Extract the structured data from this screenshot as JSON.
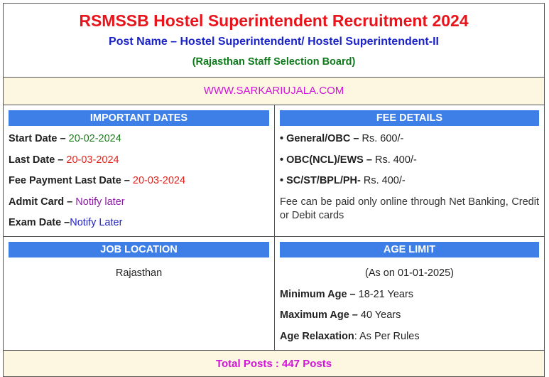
{
  "header": {
    "title": "RSMSSB Hostel Superintendent Recruitment 2024",
    "post_name": "Post Name – Hostel Superintendent/ Hostel Superintendent-II",
    "board": "(Rajasthan Staff Selection Board)"
  },
  "website": "WWW.SARKARIUJALA.COM",
  "important_dates": {
    "heading": "IMPORTANT DATES",
    "start_label": "Start Date –",
    "start_value": "20-02-2024",
    "last_label": "Last Date –",
    "last_value": "20-03-2024",
    "fee_last_label": "Fee Payment Last Date –",
    "fee_last_value": "20-03-2024",
    "admit_label": "Admit Card –",
    "admit_value": "Notify later",
    "exam_label": "Exam Date –",
    "exam_value": "Notify Later"
  },
  "fee_details": {
    "heading": "FEE DETAILS",
    "items": [
      {
        "category": "• General/OBC –",
        "amount": "Rs. 600/-"
      },
      {
        "category": "• OBC(NCL)/EWS –",
        "amount": "Rs. 400/-"
      },
      {
        "category": "• SC/ST/BPL/PH-",
        "amount": "Rs. 400/-"
      }
    ],
    "note": "Fee can be paid only online through Net Banking, Credit or Debit cards"
  },
  "job_location": {
    "heading": "JOB LOCATION",
    "value": "Rajasthan"
  },
  "age_limit": {
    "heading": "AGE LIMIT",
    "as_on": "(As on 01-01-2025)",
    "min_label": "Minimum Age –",
    "min_value": "18-21 Years",
    "max_label": "Maximum Age –",
    "max_value": "40 Years",
    "relax_label": "Age Relaxation",
    "relax_value": ": As Per Rules"
  },
  "total_posts": "Total Posts : 447 Posts",
  "colors": {
    "title": "#e8141c",
    "post_name": "#1a23c8",
    "board": "#0e7a1a",
    "accent_pink": "#d015d8",
    "header_bar": "#3d7fe6",
    "highlight_bg": "#fdf6e0"
  }
}
